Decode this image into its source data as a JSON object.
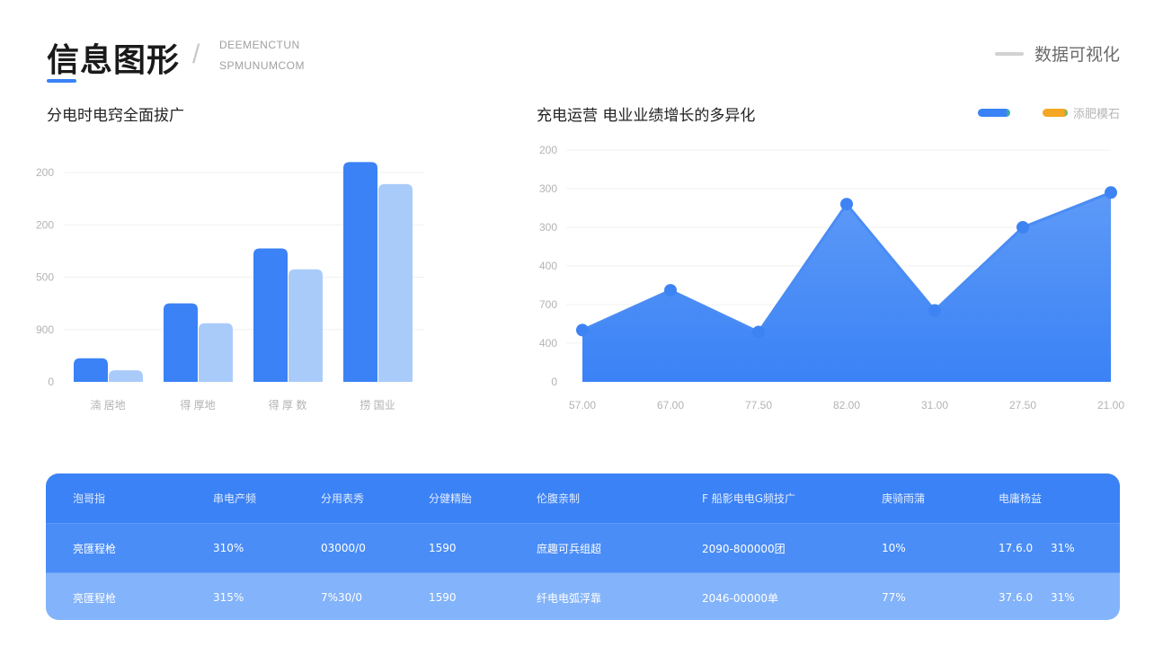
{
  "header": {
    "title": "信息图形",
    "subtitle_lines": [
      "DEEMENCTUN",
      "SPMUNUMCOM"
    ],
    "tag": "数据可视化",
    "tag_color": "#d2d2d2"
  },
  "colors": {
    "primary": "#3b82f6",
    "light": "#a9cbfa",
    "area_top": "#5d9af7",
    "area_bottom": "#3b82f6",
    "legend_orange": "#f5a623",
    "legend_green": "#3cc47c"
  },
  "chart_data": [
    {
      "type": "bar",
      "title": "分电时电窍全面拔广",
      "categories": [
        "湳 居地",
        "得 厚地",
        "得 厚 数",
        "捞 国业"
      ],
      "y_tick_labels": [
        "0",
        "900",
        "500",
        "200",
        "200"
      ],
      "ylim": [
        0,
        4
      ],
      "series": [
        {
          "values": [
            0.45,
            1.5,
            2.55,
            4.2
          ]
        },
        {
          "values": [
            0.22,
            1.12,
            2.15,
            3.78
          ]
        }
      ],
      "grid": true,
      "legend": "none"
    },
    {
      "type": "area",
      "title": "充电运营 电业业绩增长的多异化",
      "x_tick_labels": [
        "57.00",
        "67.00",
        "77.50",
        "82.00",
        "31.00",
        "27.50",
        "21.00"
      ],
      "y_tick_labels": [
        "0",
        "400",
        "700",
        "400",
        "300",
        "300",
        "200"
      ],
      "ylim": [
        0,
        6
      ],
      "values": [
        1.34,
        2.37,
        1.29,
        4.6,
        1.85,
        4.0,
        4.9
      ],
      "grid": true,
      "legend": "top-right",
      "legend_entries": [
        {
          "label": "",
          "color": "#3b82f6"
        },
        {
          "label": "添肥模石",
          "color": "#f5a623"
        }
      ]
    }
  ],
  "table": {
    "header": [
      "泡哥指",
      "串电产频",
      "分用表秀",
      "分健精胎",
      "伦腹亲制",
      "F 船影电电G频技广",
      "庚骑雨蒲",
      "电庸杨益"
    ],
    "rows": [
      [
        "亮匯程枪",
        "310%",
        "03000/0",
        "1590",
        "庶趣可兵组超",
        "2090-800000团",
        "10%",
        "17.6.0",
        "31%"
      ],
      [
        "亮匯程枪",
        "315%",
        "7%30/0",
        "1590",
        "纤电电弧浮靠",
        "2046-00000单",
        "77%",
        "37.6.0",
        "31%"
      ]
    ]
  }
}
